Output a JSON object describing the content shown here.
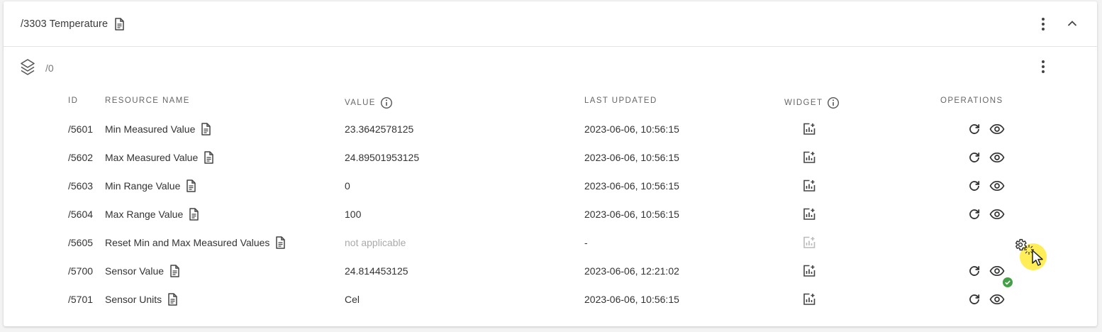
{
  "object": {
    "title": "/3303 Temperature",
    "instance": "/0"
  },
  "table": {
    "headers": {
      "id": "ID",
      "name": "RESOURCE NAME",
      "value": "VALUE",
      "last_updated": "LAST UPDATED",
      "widget": "WIDGET",
      "operations": "OPERATIONS"
    },
    "rows": [
      {
        "id": "/5601",
        "name": "Min Measured Value",
        "value": "23.3642578125",
        "updated": "2023-06-06, 10:56:15"
      },
      {
        "id": "/5602",
        "name": "Max Measured Value",
        "value": "24.89501953125",
        "updated": "2023-06-06, 10:56:15"
      },
      {
        "id": "/5603",
        "name": "Min Range Value",
        "value": "0",
        "updated": "2023-06-06, 10:56:15"
      },
      {
        "id": "/5604",
        "name": "Max Range Value",
        "value": "100",
        "updated": "2023-06-06, 10:56:15"
      },
      {
        "id": "/5605",
        "name": "Reset Min and Max Measured Values",
        "value": "not applicable",
        "updated": "-"
      },
      {
        "id": "/5700",
        "name": "Sensor Value",
        "value": "24.814453125",
        "updated": "2023-06-06, 12:21:02"
      },
      {
        "id": "/5701",
        "name": "Sensor Units",
        "value": "Cel",
        "updated": "2023-06-06, 10:56:15"
      }
    ]
  },
  "icons": {
    "doc": "document-icon",
    "info": "info-icon",
    "widget": "add-chart-icon",
    "refresh": "refresh-icon",
    "observe": "eye-icon",
    "execute": "gear-icon",
    "success": "check-circle-icon",
    "layers": "layers-icon",
    "menu": "kebab-menu-icon",
    "collapse": "chevron-up-icon"
  },
  "colors": {
    "success": "#43a047",
    "cursor_highlight": "#ffeb3b",
    "muted_text": "#aaaaaa"
  }
}
